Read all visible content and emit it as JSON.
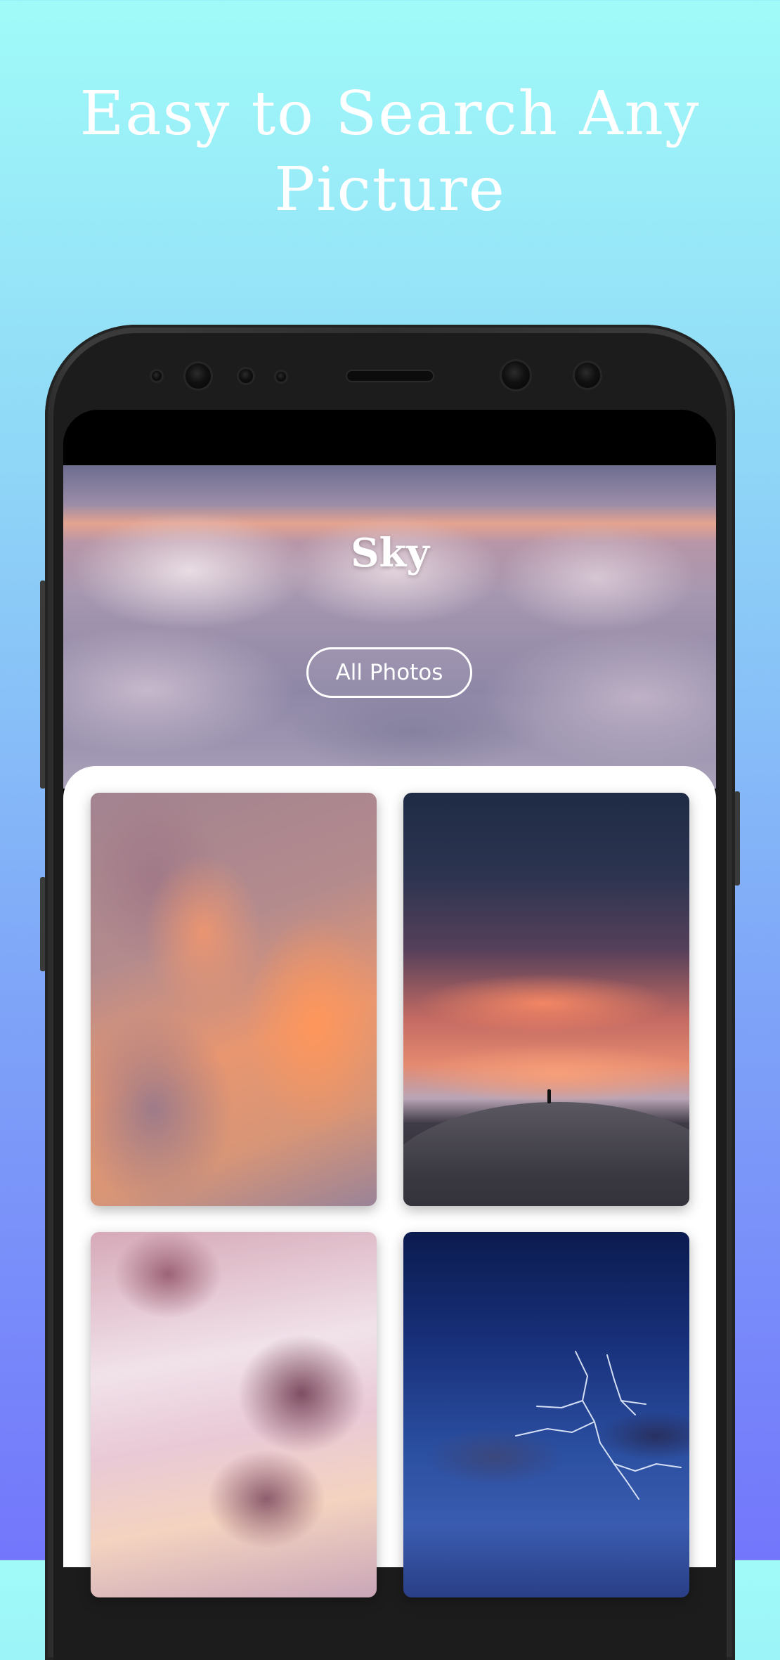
{
  "headline": {
    "line1": "Easy to Search Any",
    "line2": "Picture"
  },
  "category": {
    "title": "Sky",
    "all_photos_label": "All Photos"
  },
  "grid": {
    "photos": [
      {
        "name": "orange-cloud-tower"
      },
      {
        "name": "sunset-hill-silhouette"
      },
      {
        "name": "pink-purple-clouds"
      },
      {
        "name": "blue-night-lightning"
      }
    ]
  },
  "colors": {
    "background_top": "#a0fbf8",
    "background_bottom": "#7376fb",
    "phone_frame": "#2f2f2f",
    "sheet": "#ffffff"
  }
}
